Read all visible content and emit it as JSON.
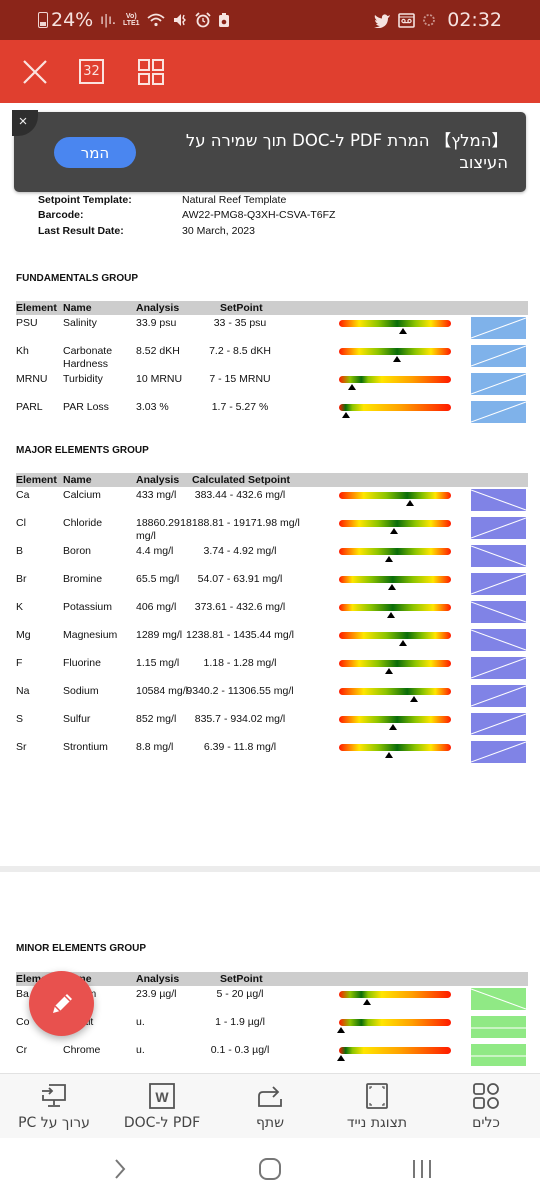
{
  "status_bar": {
    "battery_percent": "24%",
    "network_label": "Vo) LTE1",
    "time": "02:32",
    "icons_left": [
      "battery-icon",
      "signal-icon",
      "volte-icon",
      "wifi-icon",
      "mute-icon",
      "alarm-icon",
      "storage-icon"
    ],
    "icons_right": [
      "twitter-icon",
      "voicemail-icon",
      "sync-icon"
    ]
  },
  "toolbar": {
    "close_label": "close",
    "page_count": "32",
    "grid_label": "thumbnails"
  },
  "banner": {
    "text": "【המלץ】 המרת PDF ל-DOC תוך שמירה על העיצוב",
    "button_label": "המר",
    "close_symbol": "×"
  },
  "report_info": [
    {
      "label": "Setpoint Template:",
      "value": "Natural Reef Template"
    },
    {
      "label": "Barcode:",
      "value": "AW22-PMG8-Q3XH-CSVA-T6FZ"
    },
    {
      "label": "Last Result Date:",
      "value": "30 March, 2023"
    }
  ],
  "groups": [
    {
      "title": "FUNDAMENTALS GROUP",
      "headers": [
        "Element",
        "Name",
        "Analysis",
        "SetPoint"
      ],
      "thumb_color": "#7fb2ea",
      "rows": [
        {
          "element": "PSU",
          "name": "Salinity",
          "analysis": "33.9 psu",
          "setpoint": "33 - 35 psu",
          "gauge": "center",
          "marker": 0.57
        },
        {
          "element": "Kh",
          "name": "Carbonate Hardness",
          "analysis": "8.52 dKH",
          "setpoint": "7.2 - 8.5 dKH",
          "gauge": "center",
          "marker": 0.52
        },
        {
          "element": "MRNU",
          "name": "Turbidity",
          "analysis": "10 MRNU",
          "setpoint": "7 - 15 MRNU",
          "gauge": "low",
          "marker": 0.12
        },
        {
          "element": "PARL",
          "name": "PAR Loss",
          "analysis": "3.03 %",
          "setpoint": "1.7 - 5.27 %",
          "gauge": "verylow",
          "marker": 0.06
        }
      ]
    },
    {
      "title": "MAJOR ELEMENTS GROUP",
      "headers": [
        "Element",
        "Name",
        "Analysis",
        "Calculated Setpoint"
      ],
      "thumb_color": "#8083e6",
      "rows": [
        {
          "element": "Ca",
          "name": "Calcium",
          "analysis": "433 mg/l",
          "setpoint": "383.44 - 432.6 mg/l",
          "gauge": "right",
          "marker": 0.63
        },
        {
          "element": "Cl",
          "name": "Chloride",
          "analysis": "18860.29 mg/l",
          "setpoint": "18188.81 - 19171.98 mg/l",
          "gauge": "center",
          "marker": 0.49
        },
        {
          "element": "B",
          "name": "Boron",
          "analysis": "4.4 mg/l",
          "setpoint": "3.74 - 4.92 mg/l",
          "gauge": "center",
          "marker": 0.45
        },
        {
          "element": "Br",
          "name": "Bromine",
          "analysis": "65.5 mg/l",
          "setpoint": "54.07 - 63.91 mg/l",
          "gauge": "wide",
          "marker": 0.47
        },
        {
          "element": "K",
          "name": "Potassium",
          "analysis": "406 mg/l",
          "setpoint": "373.61 - 432.6 mg/l",
          "gauge": "wide",
          "marker": 0.46
        },
        {
          "element": "Mg",
          "name": "Magnesium",
          "analysis": "1289 mg/l",
          "setpoint": "1238.81 - 1435.44 mg/l",
          "gauge": "right",
          "marker": 0.57
        },
        {
          "element": "F",
          "name": "Fluorine",
          "analysis": "1.15 mg/l",
          "setpoint": "1.18 - 1.28 mg/l",
          "gauge": "center",
          "marker": 0.45
        },
        {
          "element": "Na",
          "name": "Sodium",
          "analysis": "10584 mg/l",
          "setpoint": "9340.2 - 11306.55 mg/l",
          "gauge": "right",
          "marker": 0.67
        },
        {
          "element": "S",
          "name": "Sulfur",
          "analysis": "852 mg/l",
          "setpoint": "835.7 - 934.02 mg/l",
          "gauge": "center",
          "marker": 0.48
        },
        {
          "element": "Sr",
          "name": "Strontium",
          "analysis": "8.8 mg/l",
          "setpoint": "6.39 - 11.8 mg/l",
          "gauge": "center",
          "marker": 0.45
        }
      ]
    },
    {
      "title": "MINOR ELEMENTS GROUP",
      "headers": [
        "Element",
        "Name",
        "Analysis",
        "SetPoint"
      ],
      "thumb_color": "#90e985",
      "rows": [
        {
          "element": "Ba",
          "name": "Barium",
          "analysis": "23.9 µg/l",
          "setpoint": "5 - 20 µg/l",
          "gauge": "low",
          "marker": 0.25
        },
        {
          "element": "Co",
          "name": "Cobalt",
          "analysis": "u.",
          "setpoint": "1 - 1.9 µg/l",
          "gauge": "low",
          "marker": 0.02
        },
        {
          "element": "Cr",
          "name": "Chrome",
          "analysis": "u.",
          "setpoint": "0.1 - 0.3 µg/l",
          "gauge": "verylow",
          "marker": 0.02
        }
      ]
    }
  ],
  "fab": {
    "label": "edit"
  },
  "bottom_bar": [
    {
      "label": "כלים",
      "icon": "tools-icon"
    },
    {
      "label": "תצוגת נייד",
      "icon": "mobile-view-icon"
    },
    {
      "label": "שתף",
      "icon": "share-icon"
    },
    {
      "label": "PDF ל-DOC",
      "icon": "word-icon"
    },
    {
      "label": "ערוך על PC",
      "icon": "pc-icon"
    }
  ],
  "nav_bar": [
    "back",
    "home",
    "recents"
  ]
}
